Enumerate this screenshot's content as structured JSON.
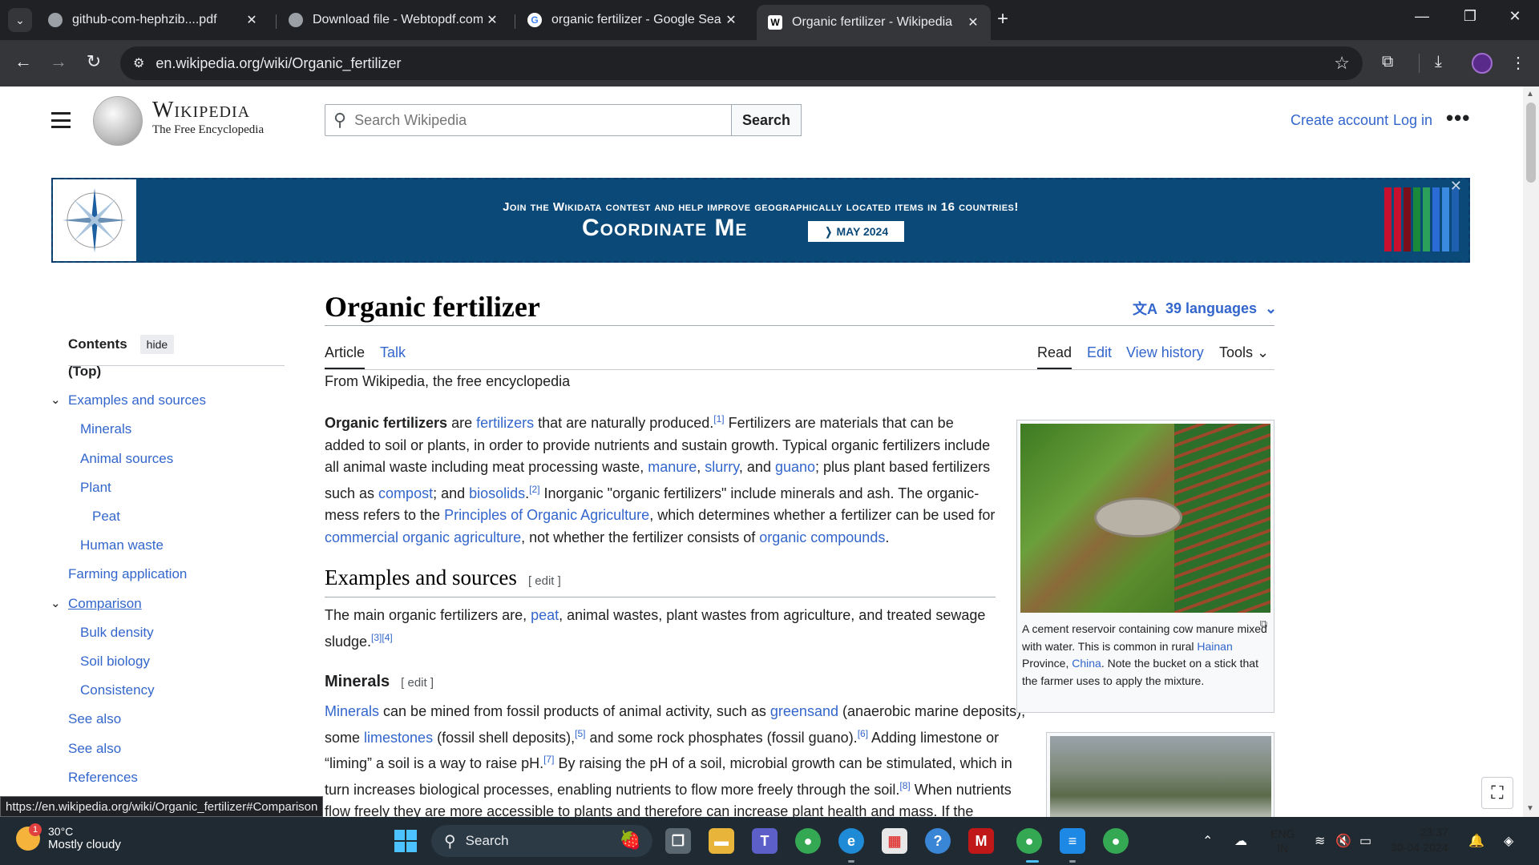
{
  "browser": {
    "tabs": [
      {
        "title": "github-com-hephzib....pdf",
        "icon": "globe-icon"
      },
      {
        "title": "Download file - Webtopdf.com",
        "icon": "globe-icon"
      },
      {
        "title": "organic fertilizer - Google Searc",
        "icon": "google-icon"
      },
      {
        "title": "Organic fertilizer - Wikipedia",
        "icon": "wikipedia-icon",
        "active": true
      }
    ],
    "url": "en.wikipedia.org/wiki/Organic_fertilizer",
    "status_url": "https://en.wikipedia.org/wiki/Organic_fertilizer#Comparison"
  },
  "header": {
    "wordmark_title": "Wikipedia",
    "wordmark_tagline": "The Free Encyclopedia",
    "search_placeholder": "Search Wikipedia",
    "search_button": "Search",
    "create_account": "Create account",
    "login": "Log in",
    "more": "•••"
  },
  "banner": {
    "line1": "Join the Wikidata contest and help improve geographically located items in 16 countries!",
    "line2": "Coordinate Me",
    "date_button": "❭ MAY 2024",
    "bar_colors": [
      "#c8102e",
      "#c8102e",
      "#7a0e1a",
      "#1a8a3a",
      "#2aa05a",
      "#2a6bd6",
      "#3a8ae0",
      "#1e5fb0"
    ]
  },
  "toc": {
    "heading": "Contents",
    "hide_label": "hide",
    "items": [
      {
        "label": "(Top)",
        "level": 0,
        "bold": true
      },
      {
        "label": "Examples and sources",
        "level": 1,
        "expanded": true
      },
      {
        "label": "Minerals",
        "level": 2
      },
      {
        "label": "Animal sources",
        "level": 2
      },
      {
        "label": "Plant",
        "level": 2
      },
      {
        "label": "Peat",
        "level": 3
      },
      {
        "label": "Human waste",
        "level": 2
      },
      {
        "label": "Farming application",
        "level": 1
      },
      {
        "label": "Comparison",
        "level": 1,
        "expanded": true,
        "underline": true
      },
      {
        "label": "Bulk density",
        "level": 2
      },
      {
        "label": "Soil biology",
        "level": 2
      },
      {
        "label": "Consistency",
        "level": 2
      },
      {
        "label": "See also",
        "level": 1
      },
      {
        "label": "See also",
        "level": 1
      },
      {
        "label": "References",
        "level": 1
      }
    ]
  },
  "article": {
    "title": "Organic fertilizer",
    "languages": "39 languages",
    "tabs_left": [
      "Article",
      "Talk"
    ],
    "tabs_right": [
      "Read",
      "Edit",
      "View history",
      "Tools"
    ],
    "from": "From Wikipedia, the free encyclopedia",
    "h2_examples": "Examples and sources",
    "h3_minerals": "Minerals",
    "edit_label": "[ edit ]"
  },
  "figures": {
    "fig1_caption_a": "A cement reservoir containing cow manure mixed with water. This is common in rural ",
    "fig1_link1": "Hainan",
    "fig1_caption_b": " Province, ",
    "fig1_link2": "China",
    "fig1_caption_c": ". Note the bucket on a stick that the farmer uses to apply the mixture."
  },
  "taskbar": {
    "temperature": "30°C",
    "weather": "Mostly cloudy",
    "weather_badge": "1",
    "search": "Search",
    "lang1": "ENG",
    "lang2": "IN",
    "time": "23:37",
    "date": "30-04-2024"
  }
}
